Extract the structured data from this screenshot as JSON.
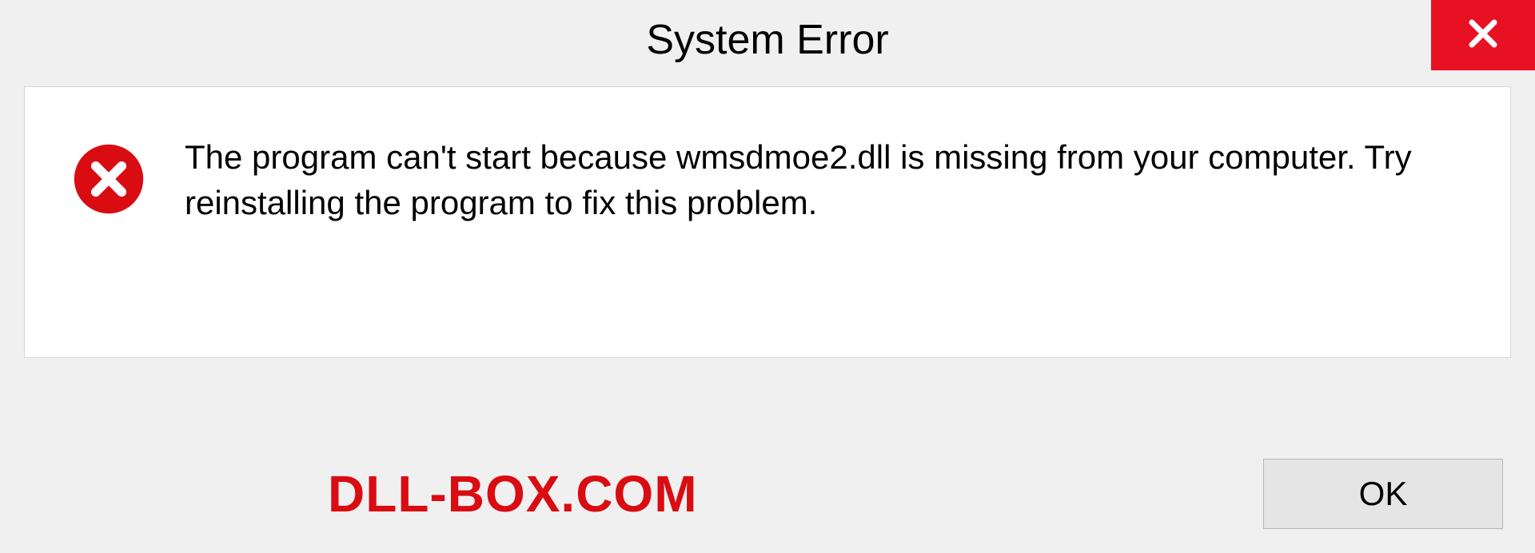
{
  "dialog": {
    "title": "System Error",
    "message": "The program can't start because wmsdmoe2.dll is missing from your computer. Try reinstalling the program to fix this problem.",
    "ok_label": "OK"
  },
  "watermark": "DLL-BOX.COM"
}
